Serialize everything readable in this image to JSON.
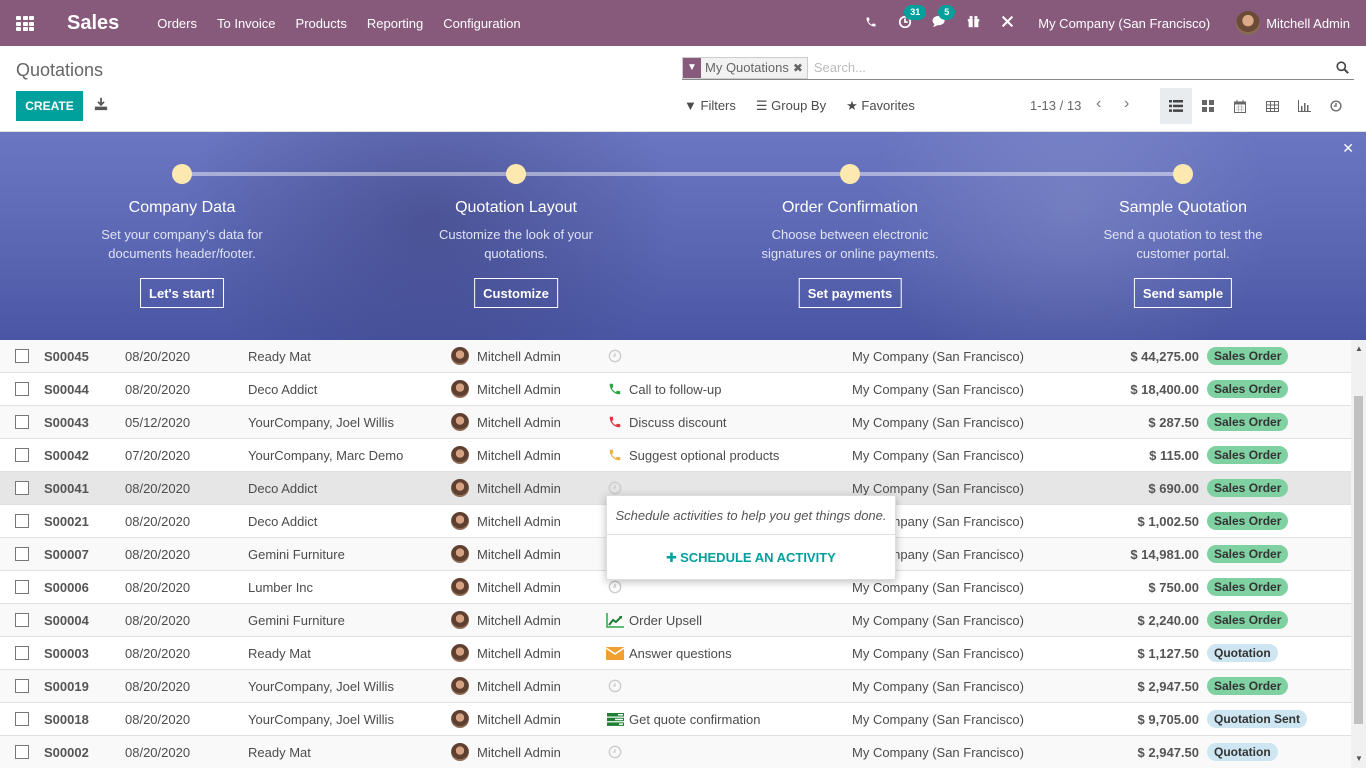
{
  "navbar": {
    "app_name": "Sales",
    "menu": [
      "Orders",
      "To Invoice",
      "Products",
      "Reporting",
      "Configuration"
    ],
    "activity_count": "31",
    "message_count": "5",
    "company": "My Company (San Francisco)",
    "user": "Mitchell Admin",
    "color": "#875a7b"
  },
  "control_panel": {
    "title": "Quotations",
    "create_label": "CREATE",
    "facet_label": "My Quotations",
    "search_placeholder": "Search...",
    "filters_label": "Filters",
    "groupby_label": "Group By",
    "favorites_label": "Favorites",
    "pager": "1-13 / 13",
    "views": [
      "list",
      "kanban",
      "calendar",
      "pivot",
      "graph",
      "activity"
    ],
    "active_view": "list",
    "accent": "#00a09d"
  },
  "onboarding": {
    "steps": [
      {
        "title": "Company Data",
        "desc_1": "Set your company's data for",
        "desc_2": "documents header/footer.",
        "button": "Let's start!"
      },
      {
        "title": "Quotation Layout",
        "desc_1": "Customize the look of your",
        "desc_2": "quotations.",
        "button": "Customize"
      },
      {
        "title": "Order Confirmation",
        "desc_1": "Choose between electronic",
        "desc_2": "signatures or online payments.",
        "button": "Set payments"
      },
      {
        "title": "Sample Quotation",
        "desc_1": "Send a quotation to test the",
        "desc_2": "customer portal.",
        "button": "Send sample"
      }
    ]
  },
  "rows": [
    {
      "number": "S00045",
      "date": "08/20/2020",
      "customer": "Ready Mat",
      "salesperson": "Mitchell Admin",
      "activity_icon": "clock",
      "activity": "",
      "company": "My Company (San Francisco)",
      "total": "$ 44,275.00",
      "status": "Sales Order"
    },
    {
      "number": "S00044",
      "date": "08/20/2020",
      "customer": "Deco Addict",
      "salesperson": "Mitchell Admin",
      "activity_icon": "phone-green",
      "activity": "Call to follow-up",
      "company": "My Company (San Francisco)",
      "total": "$ 18,400.00",
      "status": "Sales Order"
    },
    {
      "number": "S00043",
      "date": "05/12/2020",
      "customer": "YourCompany, Joel Willis",
      "salesperson": "Mitchell Admin",
      "activity_icon": "phone-red",
      "activity": "Discuss discount",
      "company": "My Company (San Francisco)",
      "total": "$ 287.50",
      "status": "Sales Order"
    },
    {
      "number": "S00042",
      "date": "07/20/2020",
      "customer": "YourCompany, Marc Demo",
      "salesperson": "Mitchell Admin",
      "activity_icon": "phone-orange",
      "activity": "Suggest optional products",
      "company": "My Company (San Francisco)",
      "total": "$ 115.00",
      "status": "Sales Order"
    },
    {
      "number": "S00041",
      "date": "08/20/2020",
      "customer": "Deco Addict",
      "salesperson": "Mitchell Admin",
      "activity_icon": "clock",
      "activity": "",
      "company": "My Company (San Francisco)",
      "total": "$ 690.00",
      "status": "Sales Order"
    },
    {
      "number": "S00021",
      "date": "08/20/2020",
      "customer": "Deco Addict",
      "salesperson": "Mitchell Admin",
      "activity_icon": "orange-bar",
      "activity": "",
      "company": "My Company (San Francisco)",
      "total": "$ 1,002.50",
      "status": "Sales Order"
    },
    {
      "number": "S00007",
      "date": "08/20/2020",
      "customer": "Gemini Furniture",
      "salesperson": "Mitchell Admin",
      "activity_icon": "",
      "activity": "",
      "company": "My Company (San Francisco)",
      "total": "$ 14,981.00",
      "status": "Sales Order"
    },
    {
      "number": "S00006",
      "date": "08/20/2020",
      "customer": "Lumber Inc",
      "salesperson": "Mitchell Admin",
      "activity_icon": "clock",
      "activity": "",
      "company": "My Company (San Francisco)",
      "total": "$ 750.00",
      "status": "Sales Order"
    },
    {
      "number": "S00004",
      "date": "08/20/2020",
      "customer": "Gemini Furniture",
      "salesperson": "Mitchell Admin",
      "activity_icon": "chart-green",
      "activity": "Order Upsell",
      "company": "My Company (San Francisco)",
      "total": "$ 2,240.00",
      "status": "Sales Order"
    },
    {
      "number": "S00003",
      "date": "08/20/2020",
      "customer": "Ready Mat",
      "salesperson": "Mitchell Admin",
      "activity_icon": "envelope-orange",
      "activity": "Answer questions",
      "company": "My Company (San Francisco)",
      "total": "$ 1,127.50",
      "status": "Quotation"
    },
    {
      "number": "S00019",
      "date": "08/20/2020",
      "customer": "YourCompany, Joel Willis",
      "salesperson": "Mitchell Admin",
      "activity_icon": "clock",
      "activity": "",
      "company": "My Company (San Francisco)",
      "total": "$ 2,947.50",
      "status": "Sales Order"
    },
    {
      "number": "S00018",
      "date": "08/20/2020",
      "customer": "YourCompany, Joel Willis",
      "salesperson": "Mitchell Admin",
      "activity_icon": "tasks-green",
      "activity": "Get quote confirmation",
      "company": "My Company (San Francisco)",
      "total": "$ 9,705.00",
      "status": "Quotation Sent"
    },
    {
      "number": "S00002",
      "date": "08/20/2020",
      "customer": "Ready Mat",
      "salesperson": "Mitchell Admin",
      "activity_icon": "clock",
      "activity": "",
      "company": "My Company (San Francisco)",
      "total": "$ 2,947.50",
      "status": "Quotation"
    }
  ],
  "popover": {
    "text": "Schedule activities to help you get things done.",
    "button": "SCHEDULE AN ACTIVITY"
  },
  "status_colors": {
    "Sales Order": "#7fd1a2",
    "Quotation": "#cde6f1",
    "Quotation Sent": "#cde6f1"
  }
}
